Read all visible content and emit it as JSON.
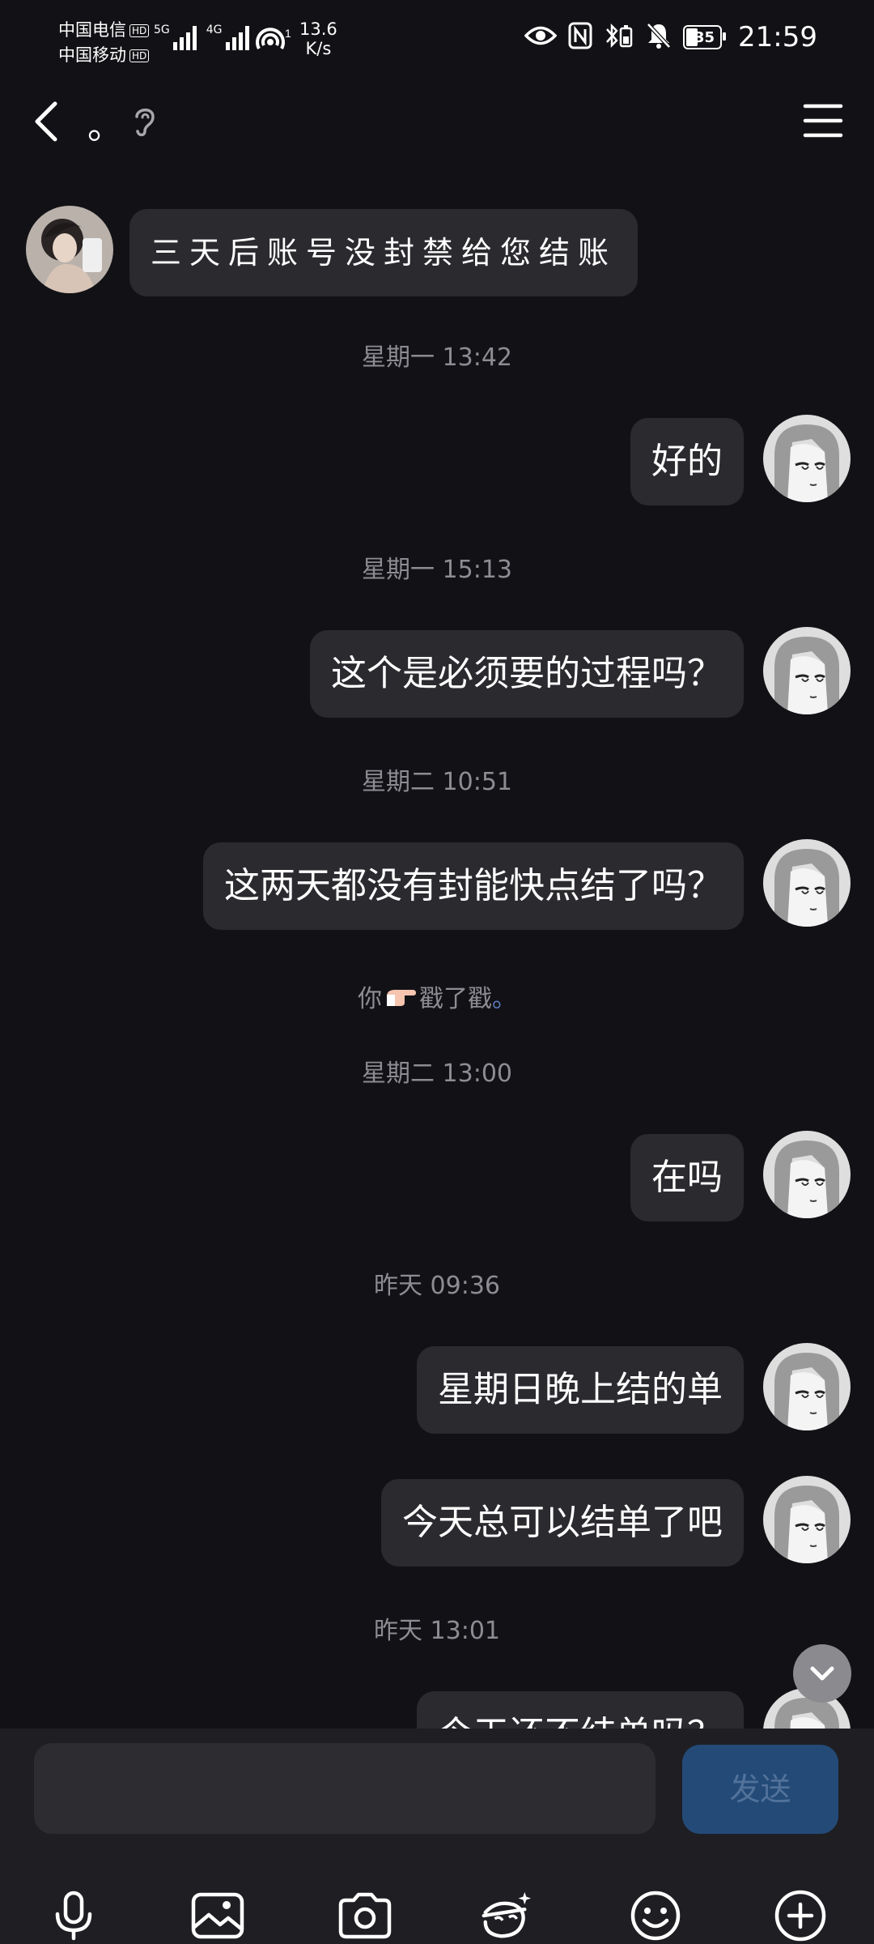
{
  "status_bar": {
    "carrier1": "中国电信",
    "carrier2": "中国移动",
    "hd_badge": "HD",
    "net_5g": "5G",
    "net_4g": "4G",
    "hotspot_count": "1",
    "speed_value": "13.6",
    "speed_unit": "K/s",
    "battery": "35",
    "time": "21:59"
  },
  "header": {
    "title": "。"
  },
  "messages": [
    {
      "type": "incoming",
      "text": "三天后账号没封禁给您结账"
    },
    {
      "type": "timestamp",
      "text": "星期一 13:42"
    },
    {
      "type": "outgoing",
      "text": "好的"
    },
    {
      "type": "timestamp",
      "text": "星期一 15:13"
    },
    {
      "type": "outgoing",
      "text": "这个是必须要的过程吗？"
    },
    {
      "type": "timestamp",
      "text": "星期二 10:51"
    },
    {
      "type": "outgoing",
      "text": "这两天都没有封能快点结了吗？"
    },
    {
      "type": "poke",
      "before": "你",
      "after": "戳了戳",
      "target": "。"
    },
    {
      "type": "timestamp",
      "text": "星期二 13:00"
    },
    {
      "type": "outgoing",
      "text": "在吗"
    },
    {
      "type": "timestamp",
      "text": "昨天 09:36"
    },
    {
      "type": "outgoing",
      "text": "星期日晚上结的单"
    },
    {
      "type": "outgoing",
      "text": "今天总可以结单了吧"
    },
    {
      "type": "timestamp",
      "text": "昨天 13:01"
    },
    {
      "type": "outgoing",
      "text": "今天还不结单吗？"
    }
  ],
  "input": {
    "value": "",
    "placeholder": "",
    "send_label": "发送"
  },
  "toolbar": {
    "icons": [
      "microphone-icon",
      "image-icon",
      "camera-icon",
      "doodle-icon",
      "emoji-icon",
      "plus-icon"
    ]
  },
  "colors": {
    "background": "#121216",
    "bubble": "#2a2a2f",
    "timestamp": "#8c8c92",
    "send_button": "#244b78"
  }
}
